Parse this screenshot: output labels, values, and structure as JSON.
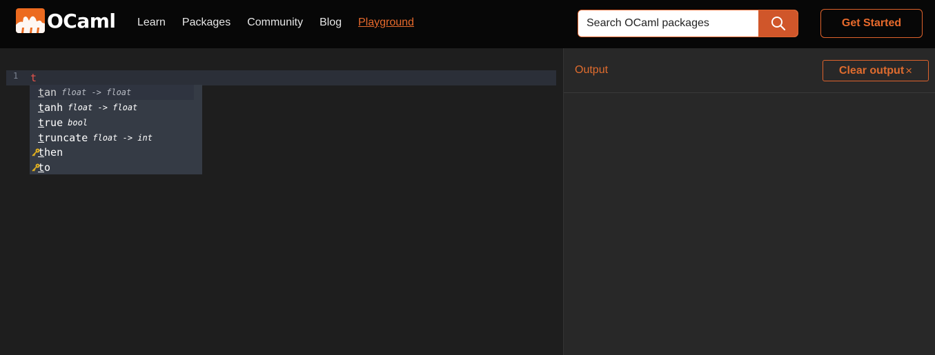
{
  "brand": {
    "name": "OCaml",
    "accent": "#ec6a1f"
  },
  "nav": {
    "items": [
      {
        "label": "Learn",
        "active": false
      },
      {
        "label": "Packages",
        "active": false
      },
      {
        "label": "Community",
        "active": false
      },
      {
        "label": "Blog",
        "active": false
      },
      {
        "label": "Playground",
        "active": true
      }
    ]
  },
  "search": {
    "placeholder": "Search OCaml packages",
    "icon": "search-icon"
  },
  "header": {
    "get_started_label": "Get Started"
  },
  "editor": {
    "line_number": "1",
    "code": "t",
    "completions": [
      {
        "match": "t",
        "rest": "an",
        "type": "float -> float",
        "kind": "value",
        "selected": true
      },
      {
        "match": "t",
        "rest": "anh",
        "type": "float -> float",
        "kind": "value",
        "selected": false
      },
      {
        "match": "t",
        "rest": "rue",
        "type": "bool",
        "kind": "value",
        "selected": false
      },
      {
        "match": "t",
        "rest": "runcate",
        "type": "float -> int",
        "kind": "value",
        "selected": false
      },
      {
        "match": "t",
        "rest": "hen",
        "type": "",
        "kind": "keyword",
        "selected": false
      },
      {
        "match": "t",
        "rest": "o",
        "type": "",
        "kind": "keyword",
        "selected": false
      }
    ]
  },
  "output": {
    "title": "Output",
    "clear_label": "Clear output",
    "clear_icon": "×"
  }
}
